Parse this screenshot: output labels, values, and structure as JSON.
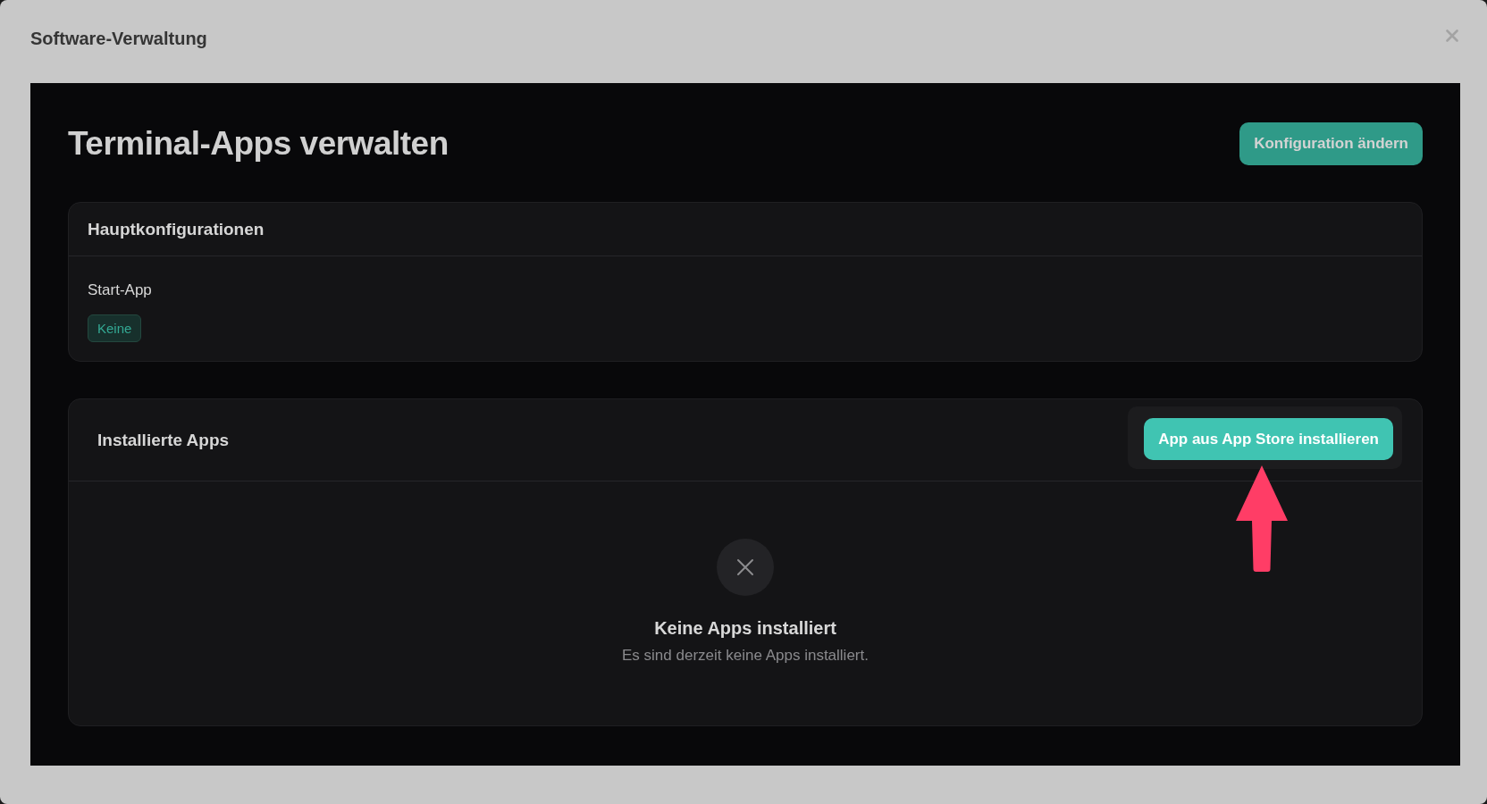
{
  "dialog": {
    "title": "Software-Verwaltung"
  },
  "page": {
    "heading": "Terminal-Apps verwalten",
    "action_button": "Konfiguration ändern"
  },
  "main_config": {
    "title": "Hauptkonfigurationen",
    "fields": [
      {
        "label": "Start-App",
        "value": "Keine"
      }
    ]
  },
  "installed_apps": {
    "title": "Installierte Apps",
    "install_button": "App aus App Store installieren",
    "empty_state": {
      "title": "Keine Apps installiert",
      "message": "Es sind derzeit keine Apps installiert."
    }
  }
}
